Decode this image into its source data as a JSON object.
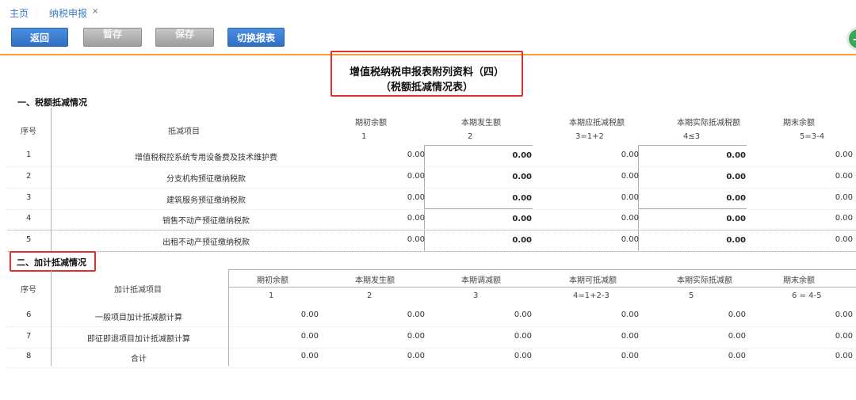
{
  "tabs": {
    "home": "主页",
    "tax": "纳税申报",
    "close": "×"
  },
  "toolbar": {
    "back": "返回",
    "save1": "暂存",
    "save2": "保存",
    "switch": "切换报表"
  },
  "title": {
    "line1": "增值税纳税申报表附列资料（四）",
    "line2": "（税额抵减情况表）"
  },
  "section1": {
    "title": "一、税额抵减情况",
    "headers": {
      "seq": "序号",
      "item": "抵减项目",
      "c1": "期初余额",
      "c2": "本期发生额",
      "c3": "本期应抵减税额",
      "c4": "本期实际抵减税额",
      "c5": "期末余额",
      "n1": "1",
      "n2": "2",
      "n3": "3=1+2",
      "n4": "4≤3",
      "n5": "5=3-4"
    },
    "rows": [
      {
        "seq": "1",
        "item": "增值税税控系统专用设备费及技术维护费",
        "v": [
          "0.00",
          "0.00",
          "0.00",
          "0.00",
          "0.00"
        ]
      },
      {
        "seq": "2",
        "item": "分支机构预征缴纳税款",
        "v": [
          "0.00",
          "0.00",
          "0.00",
          "0.00",
          "0.00"
        ]
      },
      {
        "seq": "3",
        "item": "建筑服务预征缴纳税款",
        "v": [
          "0.00",
          "0.00",
          "0.00",
          "0.00",
          "0.00"
        ]
      },
      {
        "seq": "4",
        "item": "销售不动产预征缴纳税款",
        "v": [
          "0.00",
          "0.00",
          "0.00",
          "0.00",
          "0.00"
        ]
      },
      {
        "seq": "5",
        "item": "出租不动产预征缴纳税款",
        "v": [
          "0.00",
          "0.00",
          "0.00",
          "0.00",
          "0.00"
        ]
      }
    ]
  },
  "section2": {
    "title": "二、加计抵减情况",
    "headers": {
      "seq": "序号",
      "item": "加计抵减项目",
      "c1": "期初余额",
      "c2": "本期发生额",
      "c3": "本期调减额",
      "c4": "本期可抵减额",
      "c5": "本期实际抵减额",
      "c6": "期末余额",
      "n1": "1",
      "n2": "2",
      "n3": "3",
      "n4": "4=1+2-3",
      "n5": "5",
      "n6": "6 = 4-5"
    },
    "rows": [
      {
        "seq": "6",
        "item": "一般项目加计抵减额计算",
        "v": [
          "0.00",
          "0.00",
          "0.00",
          "0.00",
          "0.00",
          "0.00"
        ]
      },
      {
        "seq": "7",
        "item": "即征即退项目加计抵减额计算",
        "v": [
          "0.00",
          "0.00",
          "0.00",
          "0.00",
          "0.00",
          "0.00"
        ]
      },
      {
        "seq": "8",
        "item": "合计",
        "v": [
          "0.00",
          "0.00",
          "0.00",
          "0.00",
          "0.00",
          "0.00"
        ]
      }
    ]
  }
}
